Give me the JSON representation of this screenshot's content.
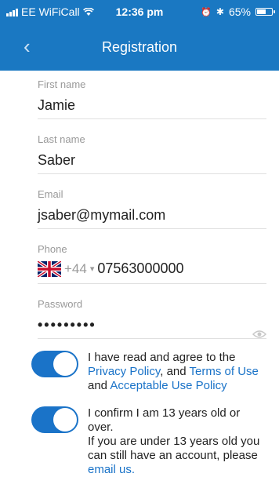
{
  "status_bar": {
    "carrier": "EE WiFiCall",
    "time": "12:36 pm",
    "battery_percent": "65%",
    "battery_level": 0.65
  },
  "nav": {
    "back_icon": "chevron-left-icon",
    "title": "Registration"
  },
  "form": {
    "first_name": {
      "label": "First name",
      "value": "Jamie"
    },
    "last_name": {
      "label": "Last name",
      "value": "Saber"
    },
    "email": {
      "label": "Email",
      "value": "jsaber@mymail.com"
    },
    "phone": {
      "label": "Phone",
      "country_code": "+44",
      "number": "07563000000"
    },
    "password": {
      "label": "Password",
      "masked_value": "•••••••••"
    }
  },
  "agreements": {
    "terms": {
      "checked": true,
      "text_before": "I have read and agree to the",
      "privacy_link": "Privacy Policy",
      "text_mid1": ", and ",
      "terms_link": "Terms of Use",
      "text_mid2": " and ",
      "aup_link": "Acceptable Use Policy"
    },
    "age": {
      "checked": true,
      "line1": "I confirm I am 13 years old or over.",
      "line2": "If you are under 13 years old you can still have an account, please ",
      "email_link": "email us",
      "line2_end": "."
    }
  },
  "colors": {
    "header": "#1a78c2",
    "accent": "#1a73c8"
  }
}
